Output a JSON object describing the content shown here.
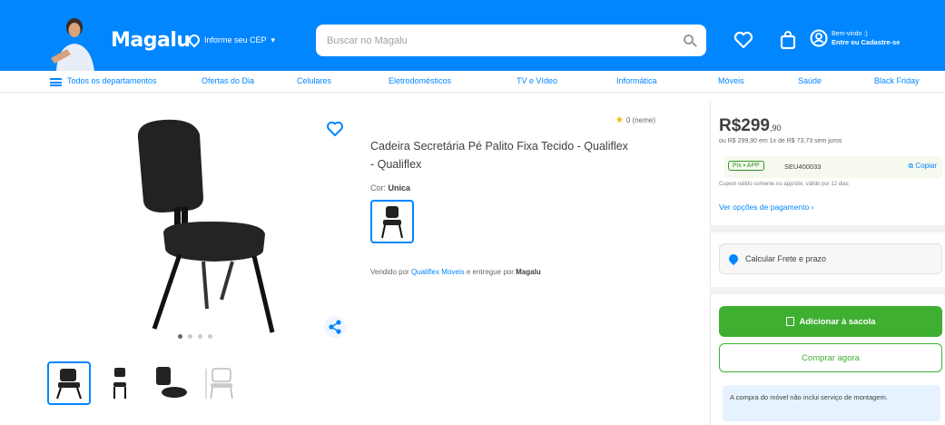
{
  "colors": {
    "brand": "#0086ff",
    "buy_green": "#3faf32",
    "star": "#f6b400"
  },
  "header": {
    "logo": "Magalu",
    "cep_label": "Informe seu CEP",
    "search_placeholder": "Buscar no Magalu",
    "account_line1": "Bem-vindo :)",
    "account_line2": "Entre ou Cadastre-se",
    "icons": [
      "heart-icon",
      "bag-icon",
      "user-icon"
    ]
  },
  "categories": [
    "Todos os departamentos",
    "Ofertas do Dia",
    "Celulares",
    "Eletrodomésticos",
    "TV e Vídeo",
    "Informática",
    "Móveis",
    "Saúde",
    "Black Friday"
  ],
  "product": {
    "rating": "0 (neme)",
    "title": "Cadeira Secretária Pé Palito Fixa Tecido - Qualiflex - Qualiflex",
    "color_prefix": "Cor:",
    "color_value": "Unica",
    "seller_prefix": "Vendido por",
    "seller_name": "Qualiflex Moveis",
    "seller_middle": "e entregue por",
    "seller_delivery": "Magalu"
  },
  "buybox": {
    "price_main": "R$299",
    "price_cents": ",90",
    "price_sub": "ou R$ 299,90 em 1x de R$ 73,73 sem juros",
    "pix_badge": "Pix ▪ APP",
    "pix_code": "SEU400033",
    "copy_label": "Copiar",
    "pix_note": "Cupom válido somente no app/site, válido por 12 dias",
    "pay_options": "Ver opções de pagamento",
    "freight": "Calcular Frete e prazo",
    "add_cart": "Adicionar à sacola",
    "buy_now": "Comprar agora",
    "info": "A compra do móvel não inclui serviço de montagem."
  }
}
